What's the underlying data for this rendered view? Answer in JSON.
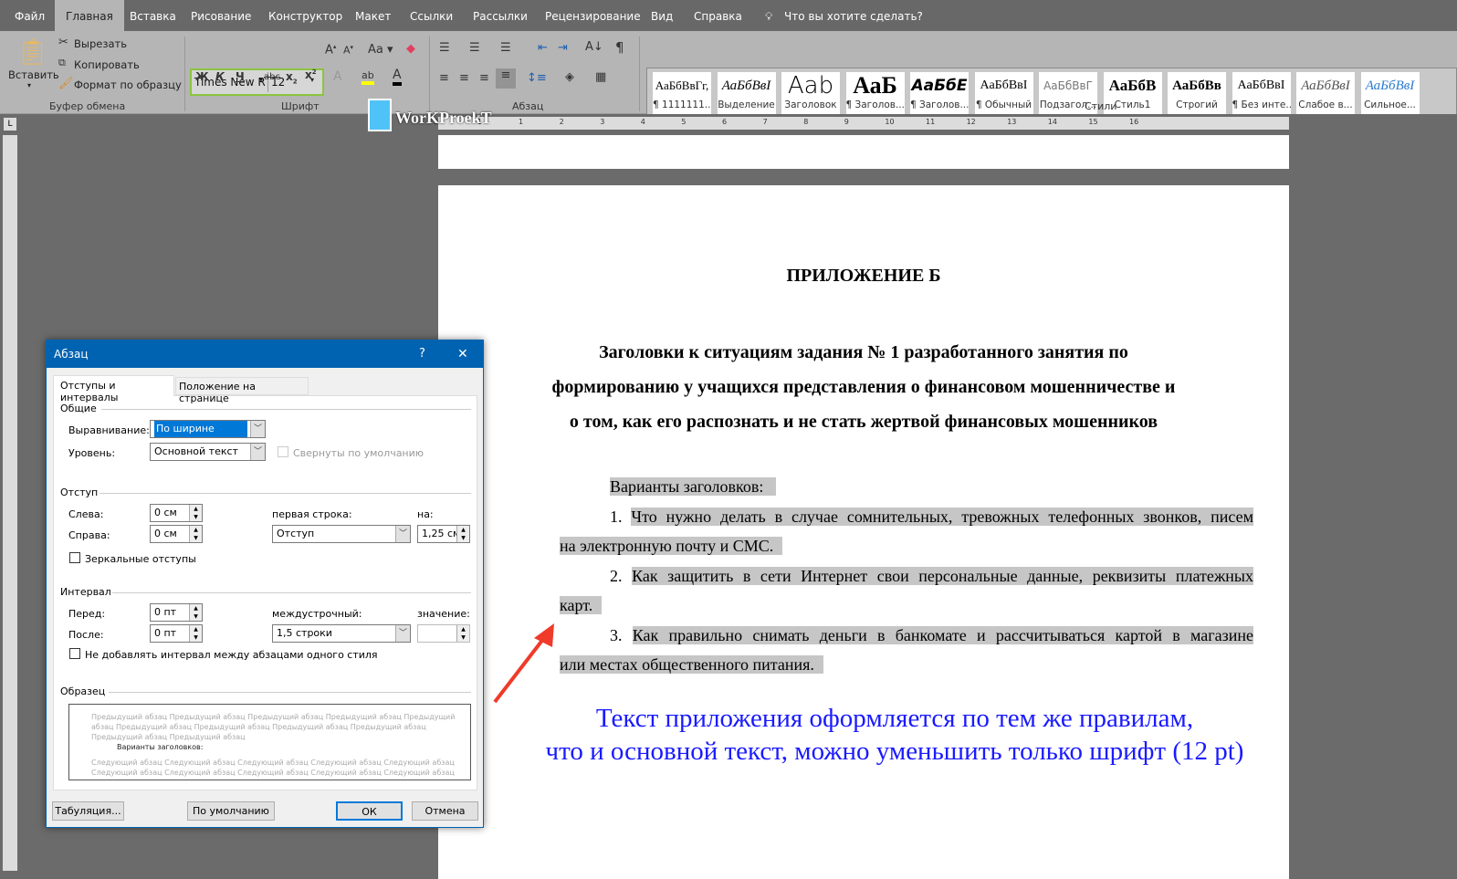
{
  "tabs": [
    "Файл",
    "Главная",
    "Вставка",
    "Рисование",
    "Конструктор",
    "Макет",
    "Ссылки",
    "Рассылки",
    "Рецензирование",
    "Вид",
    "Справка"
  ],
  "tell_me": "Что вы хотите сделать?",
  "clipboard": {
    "paste": "Вставить",
    "cut": "Вырезать",
    "copy": "Копировать",
    "format_painter": "Формат по образцу",
    "label": "Буфер обмена"
  },
  "font": {
    "name": "Times New R",
    "size": "12",
    "label": "Шрифт",
    "bold": "Ж",
    "italic": "К",
    "underline": "Ч",
    "case": "Aa"
  },
  "paragraph_label": "Абзац",
  "styles": {
    "label": "Стили",
    "items": [
      {
        "preview": "АаБбВвГг,",
        "name": "¶ 1111111..."
      },
      {
        "preview": "АаБбВвI",
        "name": "Выделение"
      },
      {
        "preview": "Aab",
        "name": "Заголовок"
      },
      {
        "preview": "АаБ",
        "name": "¶ Заголов..."
      },
      {
        "preview": "АаБбЕ",
        "name": "¶ Заголов..."
      },
      {
        "preview": "АаБбВвI",
        "name": "¶ Обычный"
      },
      {
        "preview": "АаБбВвГ",
        "name": "Подзагол..."
      },
      {
        "preview": "АаБбВ",
        "name": "Стиль1"
      },
      {
        "preview": "АаБбВв",
        "name": "Строгий"
      },
      {
        "preview": "АаБбВвI",
        "name": "¶ Без инте..."
      },
      {
        "preview": "АаБбВвI",
        "name": "Слабое в..."
      },
      {
        "preview": "АаБбВвI",
        "name": "Сильное..."
      }
    ]
  },
  "watermark": "WorKProekT",
  "ruler_numbers": [
    "2",
    "1",
    "1",
    "2",
    "3",
    "4",
    "5",
    "6",
    "7",
    "8",
    "9",
    "10",
    "11",
    "12",
    "13",
    "14",
    "15",
    "16"
  ],
  "document": {
    "title": "ПРИЛОЖЕНИЕ Б",
    "subtitle": [
      "Заголовки к ситуациям задания № 1 разработанного занятия по",
      "формированию у учащихся представления о финансовом мошенничестве и",
      "о том, как его распознать и не стать жертвой финансовых мошенников"
    ],
    "intro": "Варианты заголовков:",
    "items": [
      {
        "num": "1.",
        "line1": "Что нужно делать в случае сомнительных, тревожных телефонных звонков, писем",
        "line2": "на электронную почту и СМС."
      },
      {
        "num": "2.",
        "line1": "Как защитить в сети Интернет свои персональные данные, реквизиты платежных",
        "line2": "карт."
      },
      {
        "num": "3.",
        "line1": "Как правильно снимать деньги в банкомате и рассчитываться картой в магазине",
        "line2": "или местах общественного питания."
      }
    ],
    "note": [
      "Текст приложения оформляется по тем же правилам,",
      "что и основной текст, можно уменьшить только шрифт (12 pt)"
    ],
    "note_color": "#1a1aff"
  },
  "dialog": {
    "title": "Абзац",
    "help": "?",
    "close": "✕",
    "tabs": [
      "Отступы и интервалы",
      "Положение на странице"
    ],
    "general": "Общие",
    "alignment_label": "Выравнивание:",
    "alignment": "По ширине",
    "level_label": "Уровень:",
    "level": "Основной текст",
    "collapsed": "Свернуты по умолчанию",
    "indent": "Отступ",
    "left_label": "Слева:",
    "left": "0 см",
    "right_label": "Справа:",
    "right": "0 см",
    "first_line_label": "первая строка:",
    "first_line": "Отступ",
    "by_label": "на:",
    "by": "1,25 см",
    "mirror": "Зеркальные отступы",
    "spacing": "Интервал",
    "before_label": "Перед:",
    "before": "0 пт",
    "after_label": "После:",
    "after": "0 пт",
    "line_spacing_label": "междустрочный:",
    "line_spacing": "1,5 строки",
    "value_label": "значение:",
    "value": "",
    "no_space": "Не добавлять интервал между абзацами одного стиля",
    "sample": "Образец",
    "prev_text": [
      "Предыдущий абзац Предыдущий абзац Предыдущий абзац Предыдущий абзац Предыдущий",
      "абзац Предыдущий абзац Предыдущий абзац Предыдущий абзац Предыдущий абзац",
      "Предыдущий абзац Предыдущий абзац"
    ],
    "sample_text": "Варианты заголовков:",
    "next_text": [
      "Следующий абзац Следующий абзац Следующий абзац Следующий абзац Следующий абзац",
      "Следующий абзац Следующий абзац Следующий абзац Следующий абзац Следующий абзац"
    ],
    "tabs_button": "Табуляция...",
    "default_button": "По умолчанию",
    "ok": "ОК",
    "cancel": "Отмена"
  }
}
